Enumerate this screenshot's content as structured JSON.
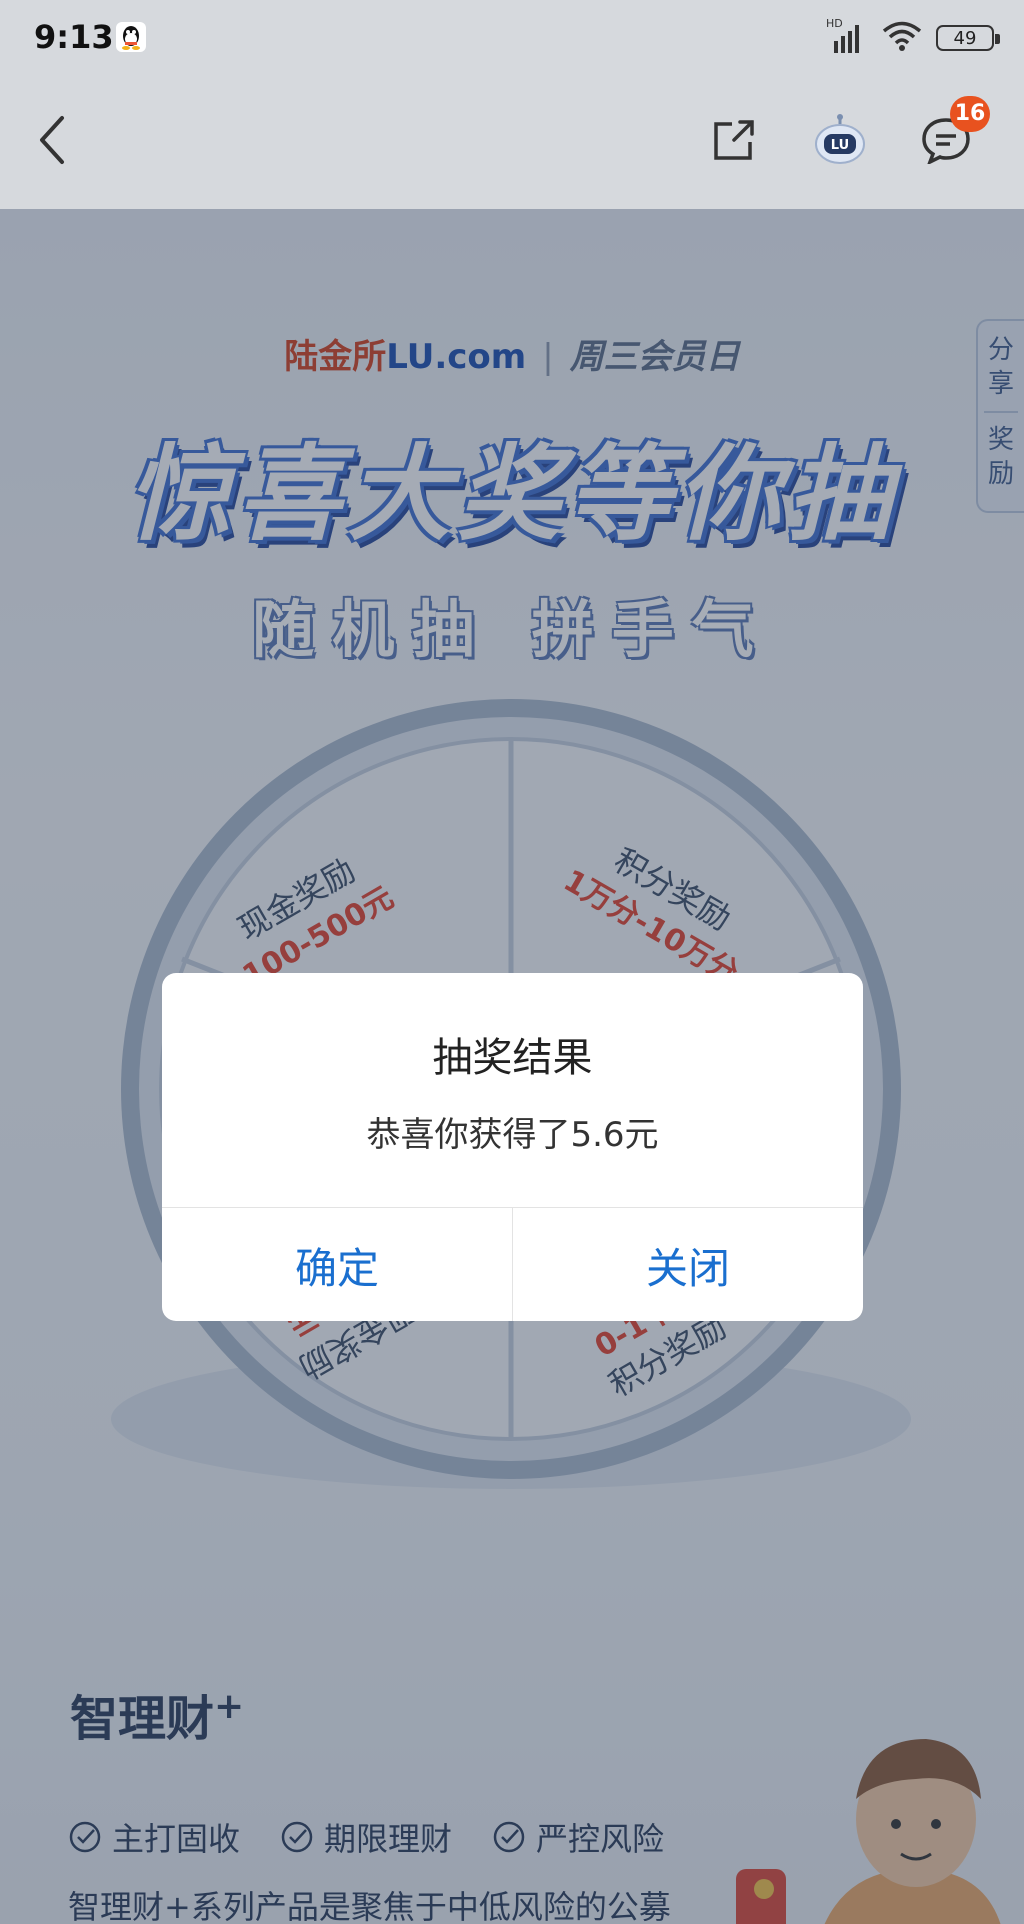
{
  "status_bar": {
    "time": "9:13",
    "network": "HD",
    "battery": "49"
  },
  "nav": {
    "message_badge": "16"
  },
  "banner": {
    "brand_name": "陆金所",
    "brand_domain": "LU.com",
    "brand_separator": "|",
    "brand_event": "周三会员日",
    "headline": "惊喜大奖等你抽",
    "subheadline": "随机抽 拼手气",
    "side_tab_top": [
      "分",
      "享"
    ],
    "side_tab_bottom": [
      "奖",
      "励"
    ]
  },
  "wheel": {
    "segments": [
      {
        "title": "现金奖励",
        "range": "100-500元"
      },
      {
        "title": "积分奖励",
        "range": "1万分-10万分"
      },
      {
        "title": "现金奖励",
        "range": "0-10元"
      },
      {
        "title": "积分奖励",
        "range": "0-1千分"
      }
    ]
  },
  "product": {
    "title": "智理财",
    "title_sup": "+",
    "features": [
      "主打固收",
      "期限理财",
      "严控风险"
    ],
    "description": "智理财+系列产品是聚焦于中低风险的公募"
  },
  "dialog": {
    "title": "抽奖结果",
    "message": "恭喜你获得了5.6元",
    "confirm_label": "确定",
    "close_label": "关闭"
  },
  "colors": {
    "accent": "#1a6fcf",
    "badge": "#e8521f",
    "brand_red": "#d2401f",
    "brand_blue": "#1c4fb0"
  }
}
